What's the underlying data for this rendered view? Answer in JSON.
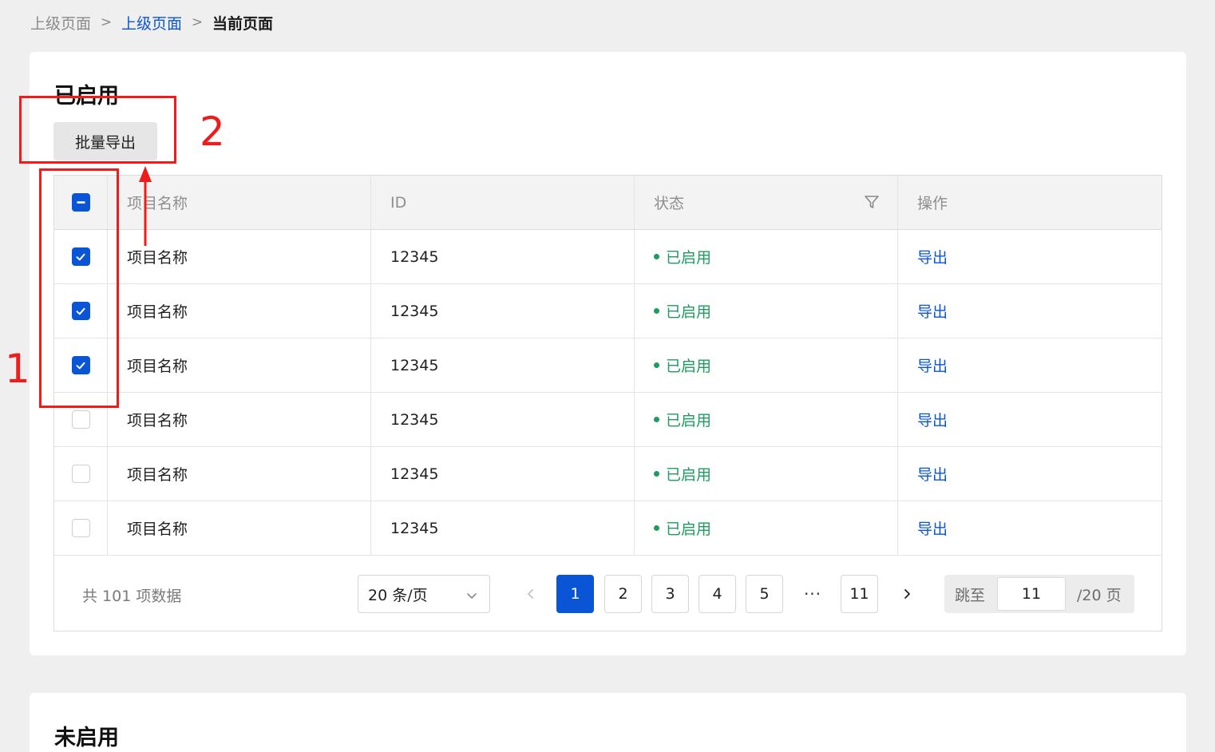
{
  "breadcrumb": {
    "items": [
      "上级页面",
      "上级页面",
      "当前页面"
    ],
    "separator": ">"
  },
  "section_enabled": {
    "title": "已启用",
    "batch_export_label": "批量导出",
    "table": {
      "columns": [
        "项目名称",
        "ID",
        "状态",
        "操作"
      ],
      "header_checkbox": "indeterminate",
      "rows": [
        {
          "checked": true,
          "name": "项目名称",
          "id": "12345",
          "status": "已启用",
          "action": "导出"
        },
        {
          "checked": true,
          "name": "项目名称",
          "id": "12345",
          "status": "已启用",
          "action": "导出"
        },
        {
          "checked": true,
          "name": "项目名称",
          "id": "12345",
          "status": "已启用",
          "action": "导出"
        },
        {
          "checked": false,
          "name": "项目名称",
          "id": "12345",
          "status": "已启用",
          "action": "导出"
        },
        {
          "checked": false,
          "name": "项目名称",
          "id": "12345",
          "status": "已启用",
          "action": "导出"
        },
        {
          "checked": false,
          "name": "项目名称",
          "id": "12345",
          "status": "已启用",
          "action": "导出"
        }
      ]
    },
    "pagination": {
      "total_text": "共 101 项数据",
      "page_size": "20 条/页",
      "pages": [
        "1",
        "2",
        "3",
        "4",
        "5"
      ],
      "ellipsis": "···",
      "last_page": "11",
      "current_page": "1",
      "jump_label": "跳至",
      "jump_value": "11",
      "jump_suffix": "/20 页"
    }
  },
  "section_disabled": {
    "title": "未启用"
  },
  "annotations": {
    "label_1": "1",
    "label_2": "2"
  },
  "colors": {
    "primary": "#0a55d6",
    "status_green": "#1e9b5e",
    "annotation_red": "#ef1c1c",
    "page_bg": "#efefef"
  }
}
